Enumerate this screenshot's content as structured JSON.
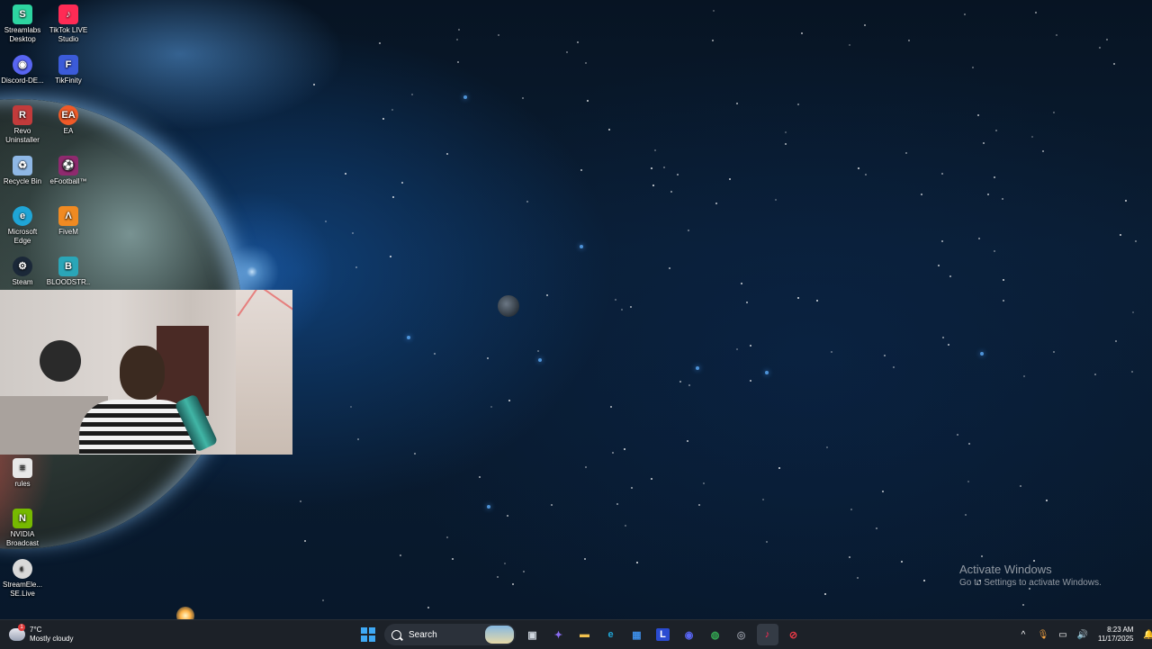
{
  "desktop": {
    "icons": [
      {
        "label": "Streamlabs Desktop",
        "icon": "streamlabs-icon",
        "color": "#2dd5a1"
      },
      {
        "label": "TikTok LIVE Studio",
        "icon": "tiktok-live-studio-icon",
        "color": "#ff2b55"
      },
      {
        "label": "Discord-DE...",
        "icon": "discord-icon",
        "color": "#5865f2"
      },
      {
        "label": "TikFinity",
        "icon": "tikfinity-icon",
        "color": "#3b5bd9"
      },
      {
        "label": "Revo Uninstaller",
        "icon": "revo-uninstaller-icon",
        "color": "#c23b3b"
      },
      {
        "label": "EA",
        "icon": "ea-icon",
        "color": "#f05a28"
      },
      {
        "label": "Recycle Bin",
        "icon": "recycle-bin-icon",
        "color": "#8fb8e6"
      },
      {
        "label": "eFootball™",
        "icon": "efootball-icon",
        "color": "#8e2a6e"
      },
      {
        "label": "Microsoft Edge",
        "icon": "edge-icon",
        "color": "#1fa5d6"
      },
      {
        "label": "FiveM",
        "icon": "fivem-icon",
        "color": "#f08a22"
      },
      {
        "label": "Steam",
        "icon": "steam-icon",
        "color": "#1b2838"
      },
      {
        "label": "BLOODSTR...",
        "icon": "bloodstrike-icon",
        "color": "#2aa6b8"
      },
      {
        "label": "rules",
        "icon": "document-icon",
        "color": "#e8e8e8"
      },
      {
        "label": "NVIDIA Broadcast",
        "icon": "nvidia-broadcast-icon",
        "color": "#76b900"
      },
      {
        "label": "StreamEle... SE.Live",
        "icon": "streamelements-icon",
        "color": "#d9d9d9"
      }
    ]
  },
  "activate_windows": {
    "title": "Activate Windows",
    "subtitle": "Go to Settings to activate Windows."
  },
  "taskbar": {
    "weather": {
      "temp": "7°C",
      "condition": "Mostly cloudy",
      "badge": "1"
    },
    "search_label": "Search",
    "apps": [
      {
        "name": "task-view-icon",
        "glyph": "▣",
        "color": "#cfd6df"
      },
      {
        "name": "copilot-icon",
        "glyph": "✦",
        "color": "#8a6cf0"
      },
      {
        "name": "file-explorer-icon",
        "glyph": "▬",
        "color": "#f2c14e"
      },
      {
        "name": "edge-icon",
        "glyph": "e",
        "color": "#1fa5d6"
      },
      {
        "name": "microsoft-store-icon",
        "glyph": "▦",
        "color": "#3d8ee8"
      },
      {
        "name": "l-app-icon",
        "glyph": "L",
        "color": "#2a4bd1"
      },
      {
        "name": "discord-icon",
        "glyph": "◉",
        "color": "#5865f2"
      },
      {
        "name": "chrome-icon",
        "glyph": "◍",
        "color": "#34a853"
      },
      {
        "name": "streamlabs-app-icon",
        "glyph": "◎",
        "color": "#8a8f99"
      },
      {
        "name": "tiktok-live-icon",
        "glyph": "♪",
        "color": "#ff2b55"
      },
      {
        "name": "streamelements-app-icon",
        "glyph": "⊘",
        "color": "#e63946"
      }
    ],
    "clock": {
      "time": "8:23 AM",
      "date": "11/17/2025"
    }
  }
}
